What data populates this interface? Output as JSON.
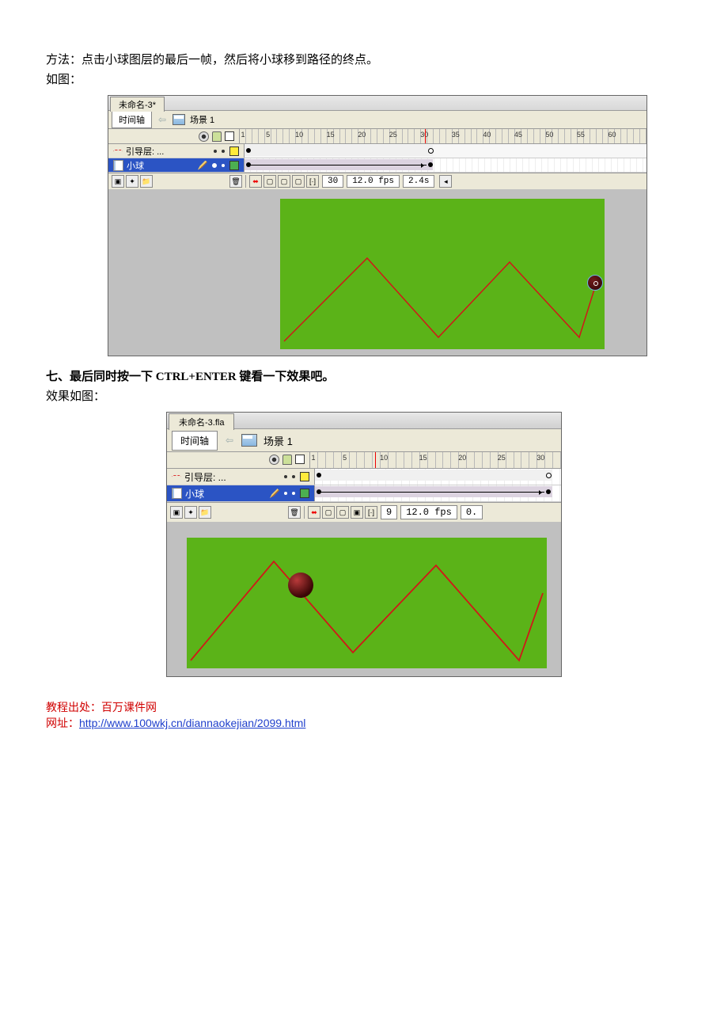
{
  "text": {
    "method": "方法：点击小球图层的最后一帧，然后将小球移到路径的终点。",
    "as_pic": "如图：",
    "seven": "七、最后同时按一下 CTRL+ENTER 键看一下效果吧。",
    "effect": "效果如图："
  },
  "screenshot1": {
    "doc_title": "未命名-3*",
    "timeline_btn": "时间轴",
    "scene": "场景 1",
    "frame_ticks": [
      1,
      5,
      10,
      15,
      20,
      25,
      30,
      35,
      40,
      45,
      50,
      55,
      60
    ],
    "layer_guide": "引导层: ...",
    "layer_ball": "小球",
    "status_frame": "30",
    "status_fps": "12.0 fps",
    "status_time": "2.4s",
    "playhead_frame": 30
  },
  "screenshot2": {
    "doc_title": "未命名-3.fla",
    "timeline_btn": "时间轴",
    "scene": "场景 1",
    "frame_ticks": [
      1,
      5,
      10,
      15,
      20,
      25,
      30
    ],
    "layer_guide": "引导层: ...",
    "layer_ball": "小球",
    "status_frame": "9",
    "status_fps": "12.0 fps",
    "status_time": "0.",
    "playhead_frame": 9
  },
  "footer": {
    "source": "教程出处：百万课件网",
    "url_label": "网址：",
    "url": "http://www.100wkj.cn/diannaokejian/2099.html"
  }
}
